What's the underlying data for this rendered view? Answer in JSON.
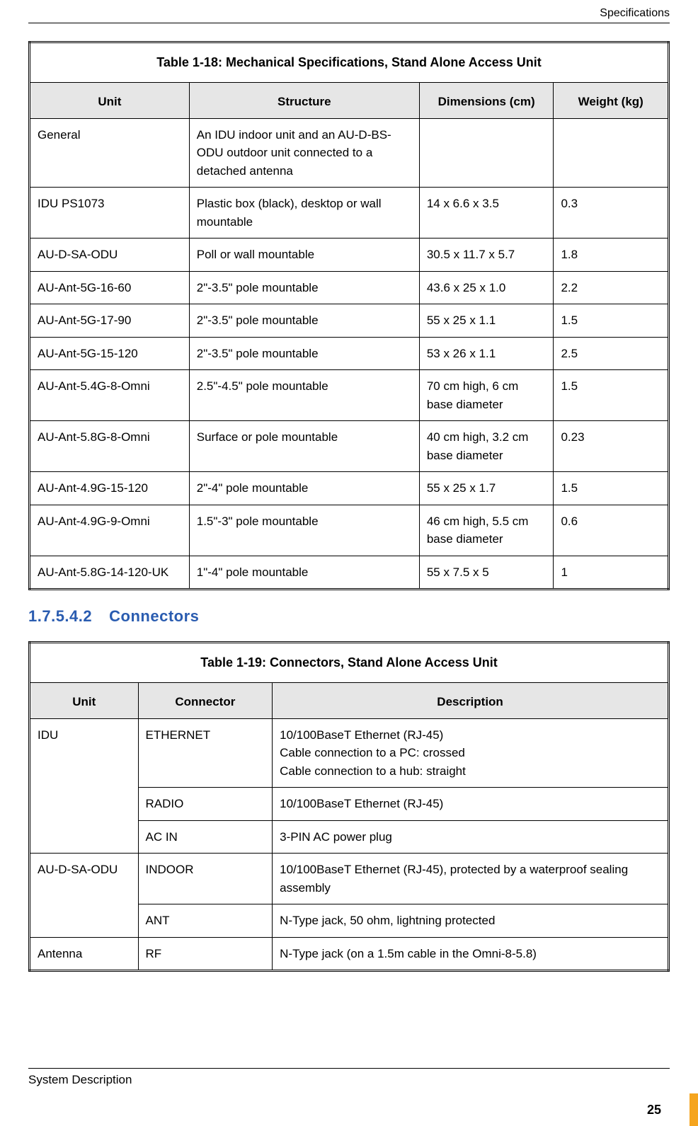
{
  "header": {
    "right": "Specifications"
  },
  "section": {
    "number": "1.7.5.4.2",
    "title": "Connectors"
  },
  "footer": {
    "text": "System Description",
    "page": "25"
  },
  "table18": {
    "caption": "Table 1-18: Mechanical Specifications, Stand Alone Access Unit",
    "cols": [
      "Unit",
      "Structure",
      "Dimensions (cm)",
      "Weight (kg)"
    ],
    "rows": [
      {
        "unit": "General",
        "structure": "An IDU indoor unit and an AU-D-BS-ODU outdoor unit connected to a detached antenna",
        "dim": "",
        "wt": ""
      },
      {
        "unit": "IDU PS1073",
        "structure": "Plastic box (black), desktop or wall mountable",
        "dim": "14 x 6.6 x 3.5",
        "wt": "0.3"
      },
      {
        "unit": "AU-D-SA-ODU",
        "structure": "Poll or wall mountable",
        "dim": "30.5 x 11.7 x 5.7",
        "wt": "1.8"
      },
      {
        "unit": "AU-Ant-5G-16-60",
        "structure": "2\"-3.5\" pole mountable",
        "dim": "43.6 x 25 x 1.0",
        "wt": "2.2"
      },
      {
        "unit": "AU-Ant-5G-17-90",
        "structure": "2\"-3.5\" pole mountable",
        "dim": "55 x 25 x 1.1",
        "wt": "1.5"
      },
      {
        "unit": "AU-Ant-5G-15-120",
        "structure": "2\"-3.5\" pole mountable",
        "dim": "53 x 26 x 1.1",
        "wt": "2.5"
      },
      {
        "unit": "AU-Ant-5.4G-8-Omni",
        "structure": "2.5\"-4.5\" pole mountable",
        "dim": "70 cm high, 6 cm base diameter",
        "wt": "1.5"
      },
      {
        "unit": "AU-Ant-5.8G-8-Omni",
        "structure": "Surface or pole mountable",
        "dim": "40 cm high, 3.2 cm base diameter",
        "wt": "0.23"
      },
      {
        "unit": "AU-Ant-4.9G-15-120",
        "structure": "2\"-4\" pole mountable",
        "dim": "55 x 25 x 1.7",
        "wt": "1.5"
      },
      {
        "unit": "AU-Ant-4.9G-9-Omni",
        "structure": "1.5\"-3\" pole mountable",
        "dim": "46 cm high, 5.5 cm base diameter",
        "wt": "0.6"
      },
      {
        "unit": "AU-Ant-5.8G-14-120-UK",
        "structure": "1\"-4\" pole mountable",
        "dim": "55 x 7.5 x 5",
        "wt": "1"
      }
    ]
  },
  "table19": {
    "caption": "Table 1-19: Connectors, Stand Alone Access Unit",
    "cols": [
      "Unit",
      "Connector",
      "Description"
    ],
    "rows": [
      {
        "unit": "IDU",
        "unit_rowspan": 3,
        "conn": "ETHERNET",
        "desc": "10/100BaseT Ethernet (RJ-45)\nCable connection to a PC: crossed\nCable connection to a hub: straight"
      },
      {
        "conn": "RADIO",
        "desc": "10/100BaseT Ethernet (RJ-45)"
      },
      {
        "conn": "AC IN",
        "desc": "3-PIN AC power plug"
      },
      {
        "unit": "AU-D-SA-ODU",
        "unit_rowspan": 2,
        "conn": "INDOOR",
        "desc": "10/100BaseT Ethernet (RJ-45), protected by a waterproof sealing assembly"
      },
      {
        "conn": "ANT",
        "desc": "N-Type jack, 50 ohm, lightning protected"
      },
      {
        "unit": "Antenna",
        "unit_rowspan": 1,
        "conn": "RF",
        "desc": "N-Type jack (on a 1.5m cable in the Omni-8-5.8)"
      }
    ]
  }
}
